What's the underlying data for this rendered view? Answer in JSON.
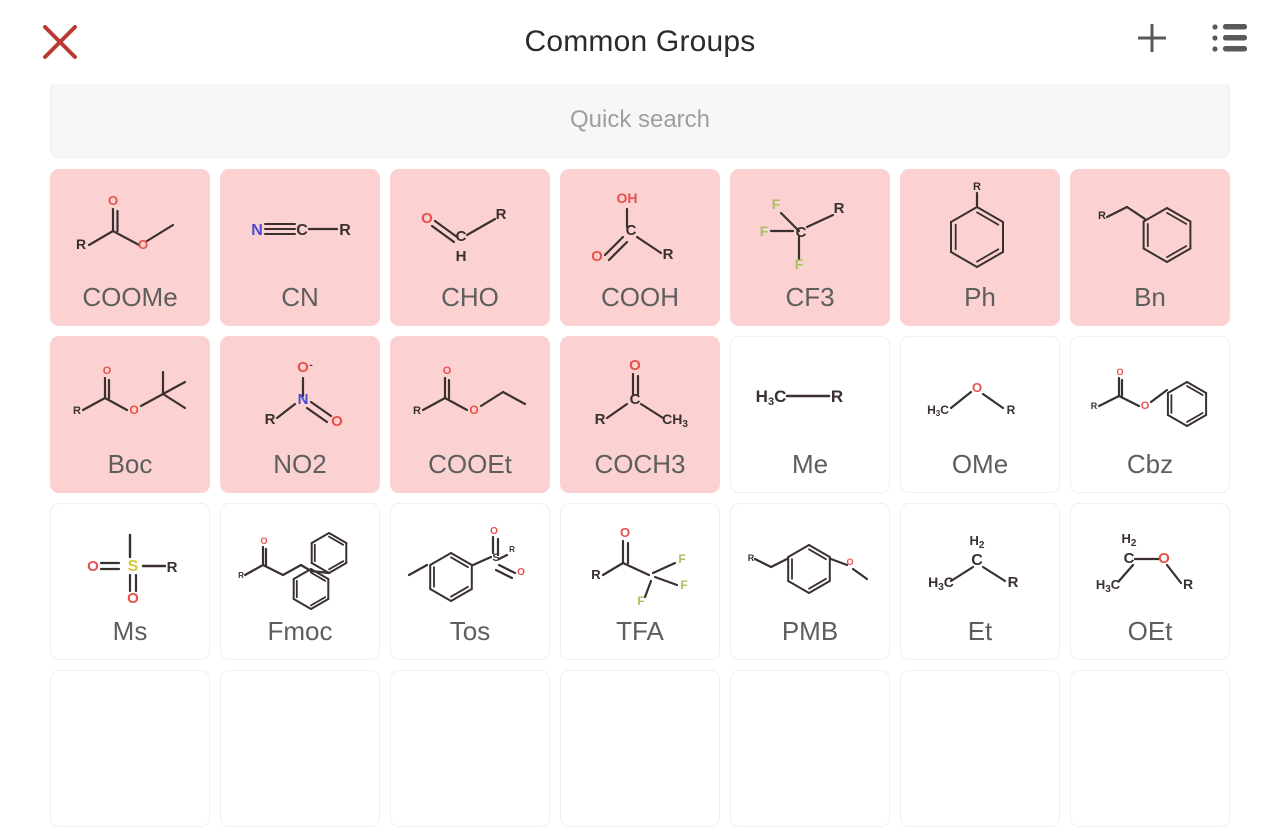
{
  "header": {
    "title": "Common Groups",
    "close_icon": "close-x-icon",
    "add_icon": "plus-icon",
    "list_icon": "list-menu-icon",
    "close_color": "#b93a33",
    "icon_color": "#5a5a5a"
  },
  "search": {
    "placeholder": "Quick search",
    "value": ""
  },
  "theme": {
    "tile_pink": "#fbd2d1",
    "tile_white": "#ffffff",
    "label_color": "#5e5e5e",
    "bond_color": "#3a3030",
    "oxygen_color": "#e8504a",
    "nitrogen_color": "#4a4ad0",
    "fluorine_color": "#a8c060",
    "sulfur_color": "#d8c83a"
  },
  "grid": {
    "columns": 7,
    "tiles": [
      {
        "label": "COOMe",
        "highlight": true,
        "structure": "coome"
      },
      {
        "label": "CN",
        "highlight": true,
        "structure": "cn"
      },
      {
        "label": "CHO",
        "highlight": true,
        "structure": "cho"
      },
      {
        "label": "COOH",
        "highlight": true,
        "structure": "cooh"
      },
      {
        "label": "CF3",
        "highlight": true,
        "structure": "cf3"
      },
      {
        "label": "Ph",
        "highlight": true,
        "structure": "ph"
      },
      {
        "label": "Bn",
        "highlight": true,
        "structure": "bn"
      },
      {
        "label": "Boc",
        "highlight": true,
        "structure": "boc"
      },
      {
        "label": "NO2",
        "highlight": true,
        "structure": "no2"
      },
      {
        "label": "COOEt",
        "highlight": true,
        "structure": "cooet"
      },
      {
        "label": "COCH3",
        "highlight": true,
        "structure": "coch3"
      },
      {
        "label": "Me",
        "highlight": false,
        "structure": "me"
      },
      {
        "label": "OMe",
        "highlight": false,
        "structure": "ome"
      },
      {
        "label": "Cbz",
        "highlight": false,
        "structure": "cbz"
      },
      {
        "label": "Ms",
        "highlight": false,
        "structure": "ms"
      },
      {
        "label": "Fmoc",
        "highlight": false,
        "structure": "fmoc"
      },
      {
        "label": "Tos",
        "highlight": false,
        "structure": "tos"
      },
      {
        "label": "TFA",
        "highlight": false,
        "structure": "tfa"
      },
      {
        "label": "PMB",
        "highlight": false,
        "structure": "pmb"
      },
      {
        "label": "Et",
        "highlight": false,
        "structure": "et"
      },
      {
        "label": "OEt",
        "highlight": false,
        "structure": "oet"
      },
      {
        "label": "",
        "highlight": false,
        "structure": ""
      },
      {
        "label": "",
        "highlight": false,
        "structure": ""
      },
      {
        "label": "",
        "highlight": false,
        "structure": ""
      },
      {
        "label": "",
        "highlight": false,
        "structure": ""
      },
      {
        "label": "",
        "highlight": false,
        "structure": ""
      },
      {
        "label": "",
        "highlight": false,
        "structure": ""
      },
      {
        "label": "",
        "highlight": false,
        "structure": ""
      }
    ]
  }
}
